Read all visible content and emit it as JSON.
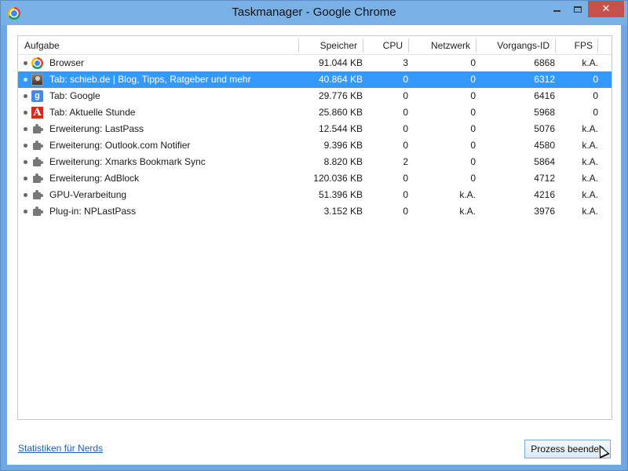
{
  "window": {
    "title": "Taskmanager - Google Chrome",
    "app_icon": "chrome-icon",
    "controls": {
      "minimize": "minimize-icon",
      "maximize": "maximize-icon",
      "close": "✕"
    }
  },
  "table": {
    "columns": [
      "Aufgabe",
      "Speicher",
      "CPU",
      "Netzwerk",
      "Vorgangs-ID",
      "FPS"
    ],
    "rows": [
      {
        "icon": "chrome-icon",
        "task": "Browser",
        "memory": "91.044 KB",
        "cpu": "3",
        "network": "0",
        "pid": "6868",
        "fps": "k.A.",
        "selected": false
      },
      {
        "icon": "avatar-icon",
        "task": "Tab: schieb.de | Blog, Tipps, Ratgeber und mehr",
        "memory": "40.864 KB",
        "cpu": "0",
        "network": "0",
        "pid": "6312",
        "fps": "0",
        "selected": true
      },
      {
        "icon": "google-icon",
        "task": "Tab: Google",
        "memory": "29.776 KB",
        "cpu": "0",
        "network": "0",
        "pid": "6416",
        "fps": "0",
        "selected": false
      },
      {
        "icon": "a-icon",
        "task": "Tab: Aktuelle Stunde",
        "memory": "25.860 KB",
        "cpu": "0",
        "network": "0",
        "pid": "5968",
        "fps": "0",
        "selected": false
      },
      {
        "icon": "puzzle-icon",
        "task": "Erweiterung: LastPass",
        "memory": "12.544 KB",
        "cpu": "0",
        "network": "0",
        "pid": "5076",
        "fps": "k.A.",
        "selected": false
      },
      {
        "icon": "puzzle-icon",
        "task": "Erweiterung: Outlook.com Notifier",
        "memory": "9.396 KB",
        "cpu": "0",
        "network": "0",
        "pid": "4580",
        "fps": "k.A.",
        "selected": false
      },
      {
        "icon": "puzzle-icon",
        "task": "Erweiterung: Xmarks Bookmark Sync",
        "memory": "8.820 KB",
        "cpu": "2",
        "network": "0",
        "pid": "5864",
        "fps": "k.A.",
        "selected": false
      },
      {
        "icon": "puzzle-icon",
        "task": "Erweiterung: AdBlock",
        "memory": "120.036 KB",
        "cpu": "0",
        "network": "0",
        "pid": "4712",
        "fps": "k.A.",
        "selected": false
      },
      {
        "icon": "puzzle-icon",
        "task": "GPU-Verarbeitung",
        "memory": "51.396 KB",
        "cpu": "0",
        "network": "k.A.",
        "pid": "4216",
        "fps": "k.A.",
        "selected": false
      },
      {
        "icon": "puzzle-icon",
        "task": "Plug-in: NPLastPass",
        "memory": "3.152 KB",
        "cpu": "0",
        "network": "k.A.",
        "pid": "3976",
        "fps": "k.A.",
        "selected": false
      }
    ]
  },
  "footer": {
    "stats_link": "Statistiken für Nerds",
    "end_process_label": "Prozess beenden"
  },
  "colors": {
    "selection": "#3399ff",
    "titlebar": "#79b1e6",
    "close_button": "#c7504a",
    "link": "#1a5fb4"
  }
}
